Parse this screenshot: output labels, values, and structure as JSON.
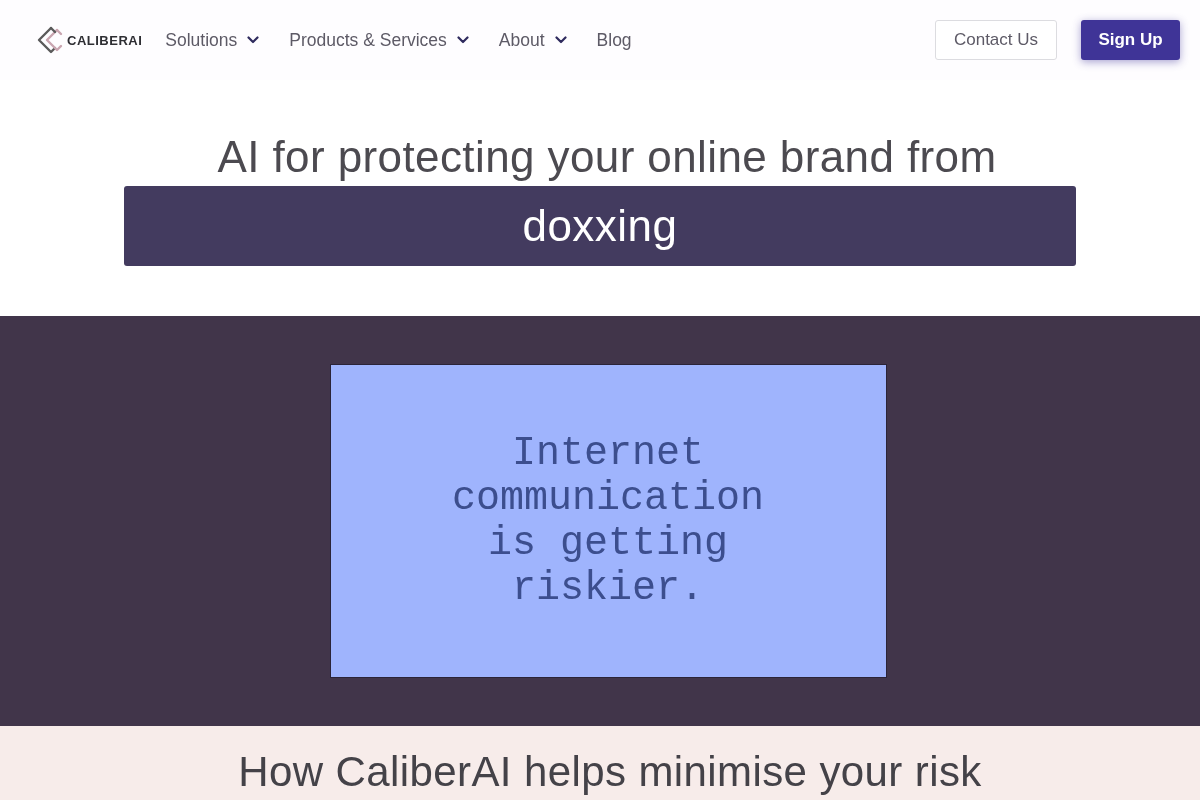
{
  "nav": {
    "logo": {
      "text": "CALIBERAI"
    },
    "items": [
      {
        "label": "Solutions",
        "dropdown": true
      },
      {
        "label": "Products & Services",
        "dropdown": true
      },
      {
        "label": "About",
        "dropdown": true
      },
      {
        "label": "Blog",
        "dropdown": false
      }
    ],
    "buttons": [
      {
        "label": "Contact Us",
        "kind": "outline"
      },
      {
        "label": "Sign Up",
        "kind": "primary"
      }
    ]
  },
  "hero": {
    "title": "AI for protecting your online brand from",
    "highlight": "doxxing"
  },
  "showcase": {
    "message": "Internet communication is getting riskier."
  },
  "features": {
    "heading": "How CaliberAI helps minimise your risk"
  }
}
